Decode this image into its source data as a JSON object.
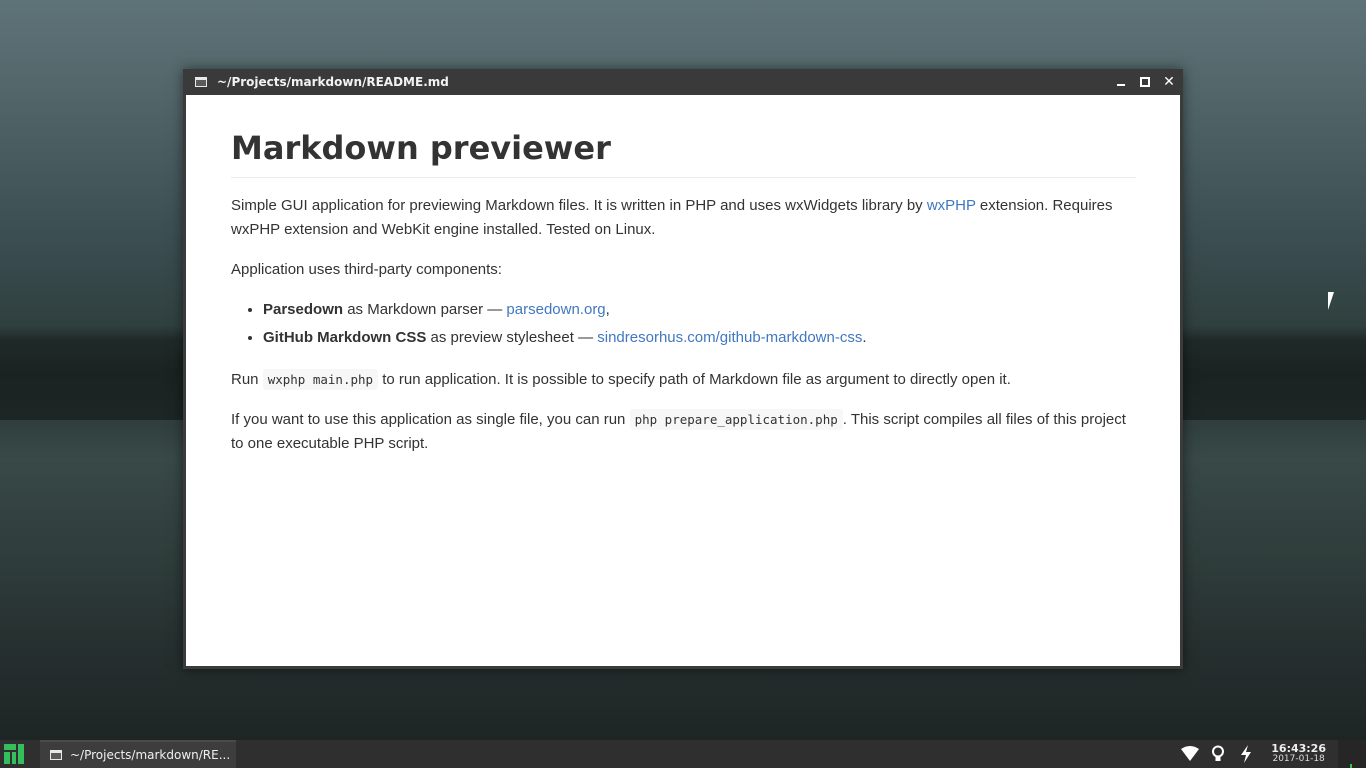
{
  "window": {
    "title": "~/Projects/markdown/README.md",
    "controls": {
      "close": "✕"
    }
  },
  "document": {
    "heading": "Markdown previewer",
    "p1": {
      "before_link": "Simple GUI application for previewing Markdown files. It is written in PHP and uses wxWidgets library by ",
      "link": "wxPHP",
      "after_link": " extension. Requires wxPHP extension and WebKit engine installed. Tested on Linux."
    },
    "p2": "Application uses third-party components:",
    "list": [
      {
        "bold": "Parsedown",
        "text": " as Markdown parser — ",
        "link": "parsedown.org",
        "tail": ","
      },
      {
        "bold": "GitHub Markdown CSS",
        "text": " as preview stylesheet — ",
        "link": "sindresorhus.com/github-markdown-css",
        "tail": "."
      }
    ],
    "p3": {
      "before_code": "Run ",
      "code": "wxphp main.php",
      "after_code": " to run application. It is possible to specify path of Markdown file as argument to directly open it."
    },
    "p4": {
      "before_code": "If you want to use this application as single file, you can run ",
      "code": "php prepare_application.php",
      "after_code": ". This script compiles all files of this project to one executable PHP script."
    },
    "link_color": "#4078c0"
  },
  "taskbar": {
    "task_label": "~/Projects/markdown/RE...",
    "clock_time": "16:43:26",
    "clock_date": "2017-01-18",
    "tray_icons": [
      "wifi-icon",
      "bulb-icon",
      "power-icon"
    ],
    "accent": "#35bf5c"
  }
}
